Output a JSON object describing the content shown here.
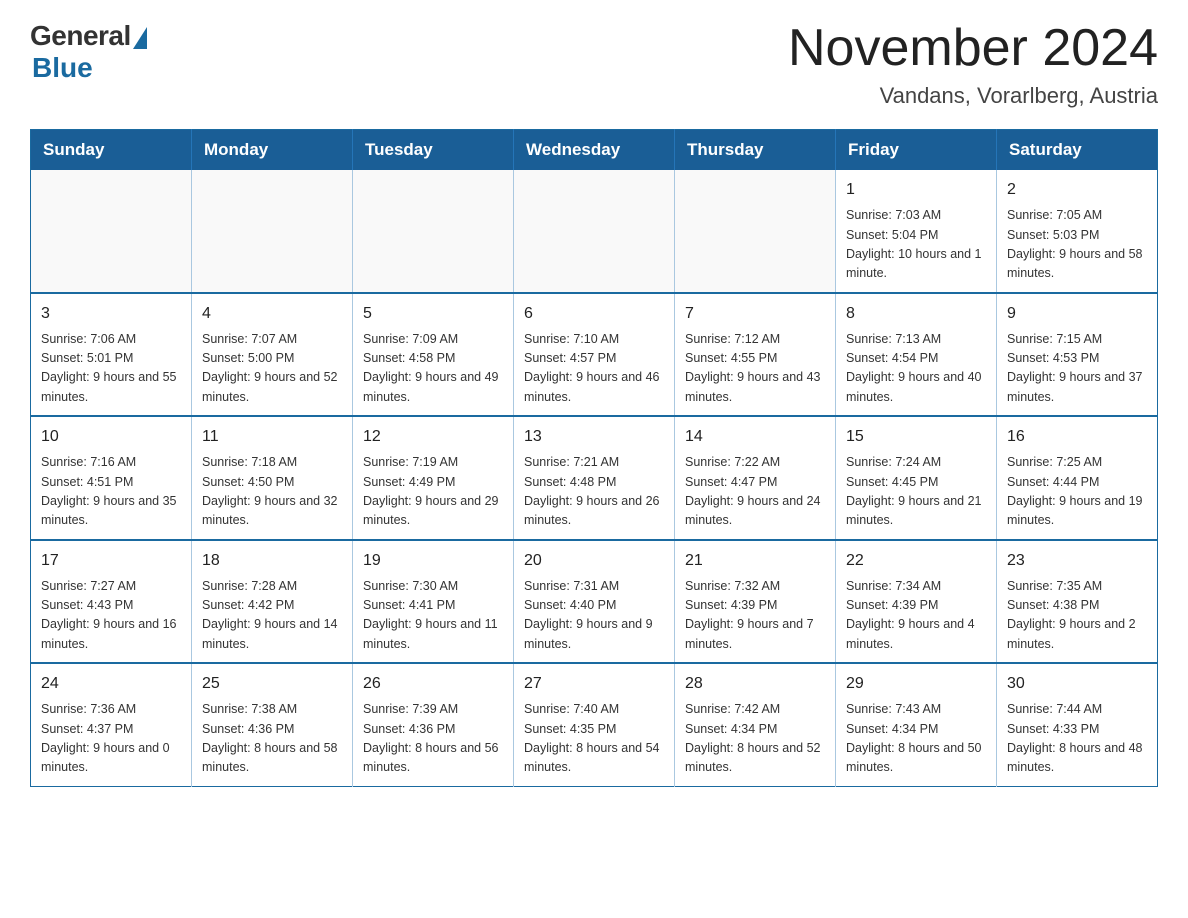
{
  "header": {
    "logo_general": "General",
    "logo_blue": "Blue",
    "month_title": "November 2024",
    "location": "Vandans, Vorarlberg, Austria"
  },
  "days_of_week": [
    "Sunday",
    "Monday",
    "Tuesday",
    "Wednesday",
    "Thursday",
    "Friday",
    "Saturday"
  ],
  "weeks": [
    [
      {
        "day": "",
        "info": ""
      },
      {
        "day": "",
        "info": ""
      },
      {
        "day": "",
        "info": ""
      },
      {
        "day": "",
        "info": ""
      },
      {
        "day": "",
        "info": ""
      },
      {
        "day": "1",
        "info": "Sunrise: 7:03 AM\nSunset: 5:04 PM\nDaylight: 10 hours and 1 minute."
      },
      {
        "day": "2",
        "info": "Sunrise: 7:05 AM\nSunset: 5:03 PM\nDaylight: 9 hours and 58 minutes."
      }
    ],
    [
      {
        "day": "3",
        "info": "Sunrise: 7:06 AM\nSunset: 5:01 PM\nDaylight: 9 hours and 55 minutes."
      },
      {
        "day": "4",
        "info": "Sunrise: 7:07 AM\nSunset: 5:00 PM\nDaylight: 9 hours and 52 minutes."
      },
      {
        "day": "5",
        "info": "Sunrise: 7:09 AM\nSunset: 4:58 PM\nDaylight: 9 hours and 49 minutes."
      },
      {
        "day": "6",
        "info": "Sunrise: 7:10 AM\nSunset: 4:57 PM\nDaylight: 9 hours and 46 minutes."
      },
      {
        "day": "7",
        "info": "Sunrise: 7:12 AM\nSunset: 4:55 PM\nDaylight: 9 hours and 43 minutes."
      },
      {
        "day": "8",
        "info": "Sunrise: 7:13 AM\nSunset: 4:54 PM\nDaylight: 9 hours and 40 minutes."
      },
      {
        "day": "9",
        "info": "Sunrise: 7:15 AM\nSunset: 4:53 PM\nDaylight: 9 hours and 37 minutes."
      }
    ],
    [
      {
        "day": "10",
        "info": "Sunrise: 7:16 AM\nSunset: 4:51 PM\nDaylight: 9 hours and 35 minutes."
      },
      {
        "day": "11",
        "info": "Sunrise: 7:18 AM\nSunset: 4:50 PM\nDaylight: 9 hours and 32 minutes."
      },
      {
        "day": "12",
        "info": "Sunrise: 7:19 AM\nSunset: 4:49 PM\nDaylight: 9 hours and 29 minutes."
      },
      {
        "day": "13",
        "info": "Sunrise: 7:21 AM\nSunset: 4:48 PM\nDaylight: 9 hours and 26 minutes."
      },
      {
        "day": "14",
        "info": "Sunrise: 7:22 AM\nSunset: 4:47 PM\nDaylight: 9 hours and 24 minutes."
      },
      {
        "day": "15",
        "info": "Sunrise: 7:24 AM\nSunset: 4:45 PM\nDaylight: 9 hours and 21 minutes."
      },
      {
        "day": "16",
        "info": "Sunrise: 7:25 AM\nSunset: 4:44 PM\nDaylight: 9 hours and 19 minutes."
      }
    ],
    [
      {
        "day": "17",
        "info": "Sunrise: 7:27 AM\nSunset: 4:43 PM\nDaylight: 9 hours and 16 minutes."
      },
      {
        "day": "18",
        "info": "Sunrise: 7:28 AM\nSunset: 4:42 PM\nDaylight: 9 hours and 14 minutes."
      },
      {
        "day": "19",
        "info": "Sunrise: 7:30 AM\nSunset: 4:41 PM\nDaylight: 9 hours and 11 minutes."
      },
      {
        "day": "20",
        "info": "Sunrise: 7:31 AM\nSunset: 4:40 PM\nDaylight: 9 hours and 9 minutes."
      },
      {
        "day": "21",
        "info": "Sunrise: 7:32 AM\nSunset: 4:39 PM\nDaylight: 9 hours and 7 minutes."
      },
      {
        "day": "22",
        "info": "Sunrise: 7:34 AM\nSunset: 4:39 PM\nDaylight: 9 hours and 4 minutes."
      },
      {
        "day": "23",
        "info": "Sunrise: 7:35 AM\nSunset: 4:38 PM\nDaylight: 9 hours and 2 minutes."
      }
    ],
    [
      {
        "day": "24",
        "info": "Sunrise: 7:36 AM\nSunset: 4:37 PM\nDaylight: 9 hours and 0 minutes."
      },
      {
        "day": "25",
        "info": "Sunrise: 7:38 AM\nSunset: 4:36 PM\nDaylight: 8 hours and 58 minutes."
      },
      {
        "day": "26",
        "info": "Sunrise: 7:39 AM\nSunset: 4:36 PM\nDaylight: 8 hours and 56 minutes."
      },
      {
        "day": "27",
        "info": "Sunrise: 7:40 AM\nSunset: 4:35 PM\nDaylight: 8 hours and 54 minutes."
      },
      {
        "day": "28",
        "info": "Sunrise: 7:42 AM\nSunset: 4:34 PM\nDaylight: 8 hours and 52 minutes."
      },
      {
        "day": "29",
        "info": "Sunrise: 7:43 AM\nSunset: 4:34 PM\nDaylight: 8 hours and 50 minutes."
      },
      {
        "day": "30",
        "info": "Sunrise: 7:44 AM\nSunset: 4:33 PM\nDaylight: 8 hours and 48 minutes."
      }
    ]
  ]
}
